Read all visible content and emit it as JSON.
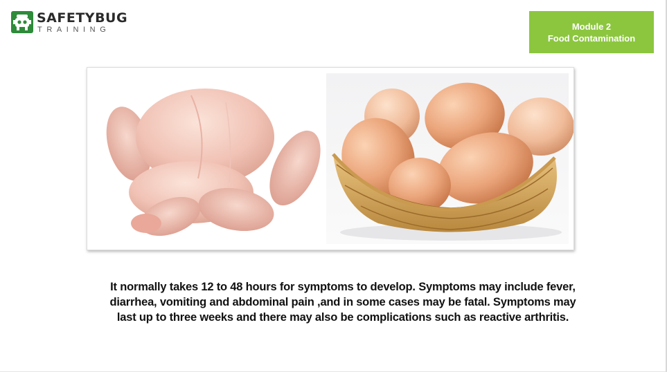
{
  "logo": {
    "title": "SAFETYBUG",
    "subtitle": "TRAINING",
    "icon": "bug-robot-icon",
    "color": "#2e8b3a"
  },
  "module_badge": {
    "line1": "Module 2",
    "line2": "Food Contamination",
    "background": "#8cc63f"
  },
  "photos": [
    {
      "name": "raw-chicken-image"
    },
    {
      "name": "eggs-in-basket-image"
    }
  ],
  "body": {
    "text": "It normally takes 12 to 48 hours for symptoms to develop. Symptoms may include fever, diarrhea, vomiting and abdominal pain ,and in some cases may be fatal. Symptoms may last up to three weeks and there may also be complications such as reactive arthritis."
  }
}
